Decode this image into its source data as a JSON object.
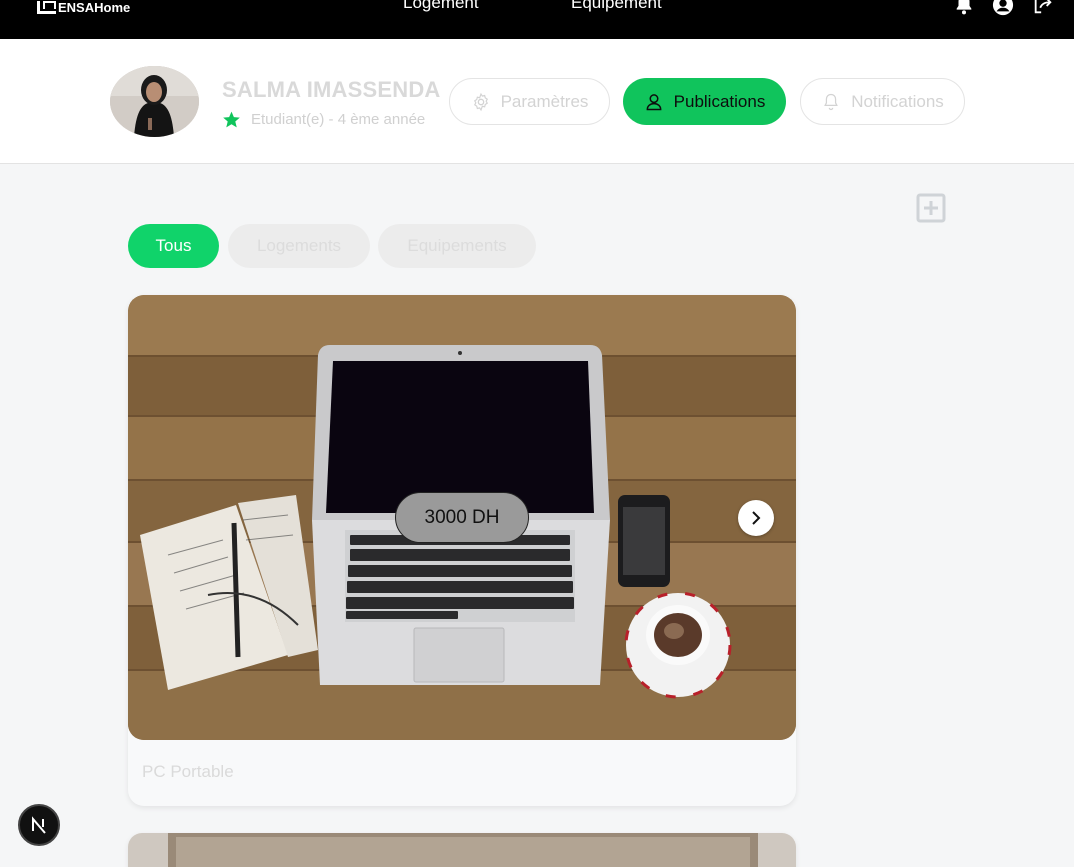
{
  "topnav": {
    "brand": "ENSAHome",
    "links": [
      "Logement",
      "Equipement"
    ],
    "icons": [
      "bell-icon",
      "user-circle-icon",
      "logout-icon"
    ]
  },
  "profile": {
    "name": "SALMA IMASSENDA",
    "subtitle": "Etudiant(e) - 4 ème année",
    "tabs": {
      "params": "Paramètres",
      "pubs": "Publications",
      "notifs": "Notifications"
    }
  },
  "filters": [
    "Tous",
    "Logements",
    "Equipements"
  ],
  "posts": [
    {
      "price": "3000 DH",
      "title": "PC Portable"
    }
  ],
  "colors": {
    "accent": "#10c45c",
    "nav_bg": "#000000",
    "page_bg": "#f5f6f7"
  }
}
